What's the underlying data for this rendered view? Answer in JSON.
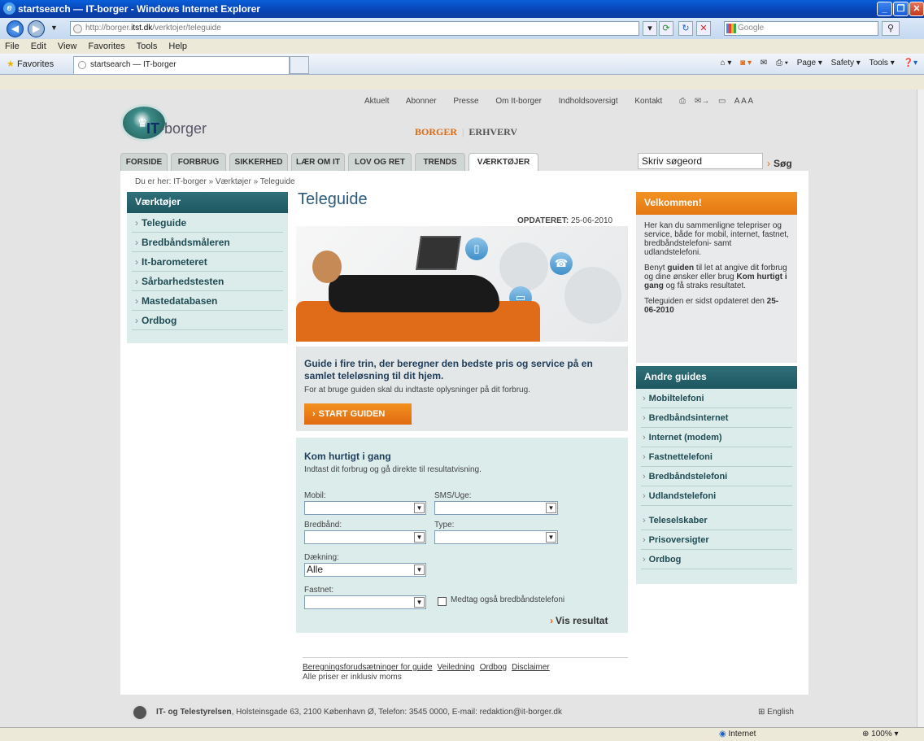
{
  "browser": {
    "title": "startsearch — IT-borger - Windows Internet Explorer",
    "url_prefix": "http://borger.",
    "url_domain": "itst.dk",
    "url_path": "/verktojer/teleguide",
    "search_placeholder": "Google",
    "menu": [
      "File",
      "Edit",
      "View",
      "Favorites",
      "Tools",
      "Help"
    ],
    "favorites_label": "Favorites",
    "tab_title": "startsearch — IT-borger",
    "cmd": [
      "Page ▾",
      "Safety ▾",
      "Tools ▾"
    ],
    "status_zone": "Internet",
    "zoom": "100%"
  },
  "site": {
    "toplinks": [
      "Aktuelt",
      "Abonner",
      "Presse",
      "Om It-borger",
      "Indholdsoversigt",
      "Kontakt"
    ],
    "text_size": "A A A",
    "brand_bold": "IT",
    "brand_rest": "-borger",
    "audience_active": "BORGER",
    "audience_sep": "|",
    "audience_other": "ERHVERV",
    "tabs": [
      "FORSIDE",
      "FORBRUG",
      "SIKKERHED",
      "LÆR OM IT",
      "LOV OG RET",
      "TRENDS",
      "VÆRKTØJER"
    ],
    "search_placeholder": "Skriv søgeord",
    "search_button": "Søg",
    "breadcrumb": "Du er her: IT-borger » Værktøjer » Teleguide"
  },
  "leftnav": {
    "heading": "Værktøjer",
    "items": [
      "Teleguide",
      "Bredbåndsmåleren",
      "It-barometeret",
      "Sårbarhedstesten",
      "Mastedatabasen",
      "Ordbog"
    ]
  },
  "main": {
    "title": "Teleguide",
    "updated_label": "OPDATERET:",
    "updated_date": "25-06-2010",
    "guide_title": "Guide i fire trin, der beregner den bedste pris og service på en samlet teleløsning til dit hjem.",
    "guide_sub": "For at bruge guiden skal du indtaste oplysninger på dit forbrug.",
    "start_button": "START GUIDEN",
    "quick_title": "Kom hurtigt i gang",
    "quick_sub": "Indtast dit forbrug og gå direkte til resultatvisning.",
    "labels": {
      "mobil": "Mobil:",
      "sms": "SMS/Uge:",
      "bredband": "Bredbånd:",
      "type": "Type:",
      "daekning": "Dækning:",
      "fastnet": "Fastnet:"
    },
    "daekning_value": "Alle",
    "checkbox_label": "Medtag også bredbåndstelefoni",
    "vis_resultat": "Vis resultat",
    "footer_links": [
      "Beregningsforudsætninger for guide",
      "Veiledning",
      "Ordbog",
      "Disclaimer"
    ],
    "footer_note": "Alle priser er inklusiv moms"
  },
  "welcome": {
    "heading": "Velkommen!",
    "p1": "Her kan du sammenligne telepriser og service, både for mobil, internet, fastnet, bredbåndstelefoni- samt udlandstelefoni.",
    "p2_a": "Benyt ",
    "p2_b": "guiden",
    "p2_c": " til let at angive dit forbrug og dine ønsker eller brug ",
    "p2_d": "Kom hurtigt i gang",
    "p2_e": " og få straks resultatet.",
    "p3_a": "Teleguiden er sidst opdateret den ",
    "p3_b": "25-06-2010"
  },
  "andre": {
    "heading": "Andre guides",
    "items": [
      "Mobiltelefoni",
      "Bredbåndsinternet",
      "Internet (modem)",
      "Fastnettelefoni",
      "Bredbåndstelefoni",
      "Udlandstelefoni"
    ],
    "items2": [
      "Teleselskaber",
      "Prisoversigter",
      "Ordbog"
    ]
  },
  "footer": {
    "org": "IT- og Telestyrelsen",
    "address": ", Holsteinsgade 63, 2100 København Ø, Telefon: 3545 0000, E-mail: redaktion@it-borger.dk",
    "english": "English"
  }
}
